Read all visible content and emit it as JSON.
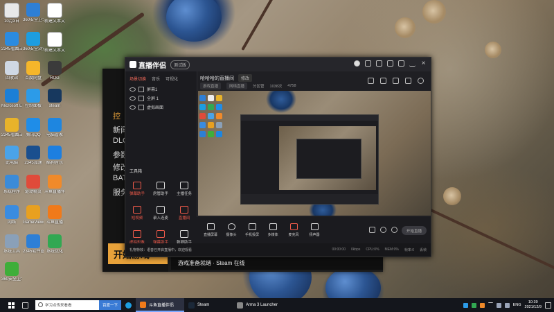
{
  "desktop_icons": [
    {
      "label": "10月3日",
      "color": "#e8e8e8"
    },
    {
      "label": "360安全卫士",
      "color": "#2e7fd6"
    },
    {
      "label": "新建文本文档",
      "color": "#ffffff"
    },
    {
      "label": "2345看图王",
      "color": "#2b8be0"
    },
    {
      "label": "360安全浏览器",
      "color": "#1d9de0"
    },
    {
      "label": "新建文本文档",
      "color": "#ffffff"
    },
    {
      "label": "回收站",
      "color": "#cfd8e4"
    },
    {
      "label": "百度网盘",
      "color": "#f5b62a"
    },
    {
      "label": "ROG",
      "color": "#3b3b3b"
    },
    {
      "label": "Microsoft Edge",
      "color": "#1b7fd6"
    },
    {
      "label": "控制面板",
      "color": "#2c9be8"
    },
    {
      "label": "steam",
      "color": "#17385e"
    },
    {
      "label": "2345看图王",
      "color": "#e8b32a"
    },
    {
      "label": "腾讯QQ",
      "color": "#1f8de8"
    },
    {
      "label": "电脑管家",
      "color": "#1e86e0"
    },
    {
      "label": "此电脑",
      "color": "#4aa3e8"
    },
    {
      "label": "2345加速",
      "color": "#1a4f8e"
    },
    {
      "label": "酷狗音乐",
      "color": "#1d7fe0"
    },
    {
      "label": "系统程序",
      "color": "#3b8bd8"
    },
    {
      "label": "驱动精灵",
      "color": "#e04b3a"
    },
    {
      "label": "斗鱼直播伴侣",
      "color": "#f08a2a"
    },
    {
      "label": "网络",
      "color": "#3a8ce0"
    },
    {
      "label": "GameViewer",
      "color": "#e8a020"
    },
    {
      "label": "斗鱼直播",
      "color": "#f07a1a"
    },
    {
      "label": "系统工具",
      "color": "#8aa0b8"
    },
    {
      "label": "2345软件管家",
      "color": "#2d7fd6"
    },
    {
      "label": "系统优化",
      "color": "#32a852"
    },
    {
      "label": "360安全卫士",
      "color": "#3fae3a"
    }
  ],
  "launcher": {
    "menu": [
      "控",
      "新闻",
      "DLC",
      "参数",
      "修改",
      "BAT",
      "服务"
    ],
    "play_label": "开始游戏",
    "status_text": "游戏准备就绪 · Steam 在线"
  },
  "app": {
    "title": "直播伴侣",
    "version": "测试版",
    "left_tabs": [
      "场景切换",
      "音乐",
      "可视化"
    ],
    "scenes": [
      "屏幕1",
      "全屏 1",
      "虚拟画面"
    ],
    "tools_header": "工具箱",
    "tools": [
      {
        "label": "弹幕助手",
        "red": true
      },
      {
        "label": "房管助手",
        "red": false
      },
      {
        "label": "主播任务",
        "red": false
      },
      {
        "label": "短视频",
        "red": true
      },
      {
        "label": "录入连麦",
        "red": false
      },
      {
        "label": "直播间",
        "red": true
      },
      {
        "label": "虚拟形象",
        "red": true
      },
      {
        "label": "弹幕助手",
        "red": true
      },
      {
        "label": "数据助手",
        "red": false
      }
    ],
    "room_title": "哈哈哈的直播间",
    "room_tag": "修改",
    "info": [
      "游戏直播",
      "网络直播",
      "分区管",
      "1038次",
      "4758"
    ],
    "controls": [
      {
        "label": "直播屏幕",
        "shape": "square"
      },
      {
        "label": "摄像头",
        "shape": "round"
      },
      {
        "label": "手机投屏",
        "shape": "square"
      },
      {
        "label": "多媒体",
        "shape": "square"
      },
      {
        "label": "麦克风",
        "shape": "mic"
      },
      {
        "label": "扬声器",
        "shape": "square"
      }
    ],
    "start_live": "开始直播",
    "notice": "礼物特效：语音已开启直播中，欢迎观看",
    "stats": [
      "00:00:00",
      "0kbps",
      "CPU:0%",
      "MEM:0%",
      "帧率:0",
      "丢帧"
    ]
  },
  "taskbar": {
    "search_placeholder": "学习点传来看看",
    "baidu_label": "百度一下",
    "apps": [
      {
        "label": "斗鱼直播伴侣",
        "color": "#f07a1a",
        "active": true
      },
      {
        "label": "Steam",
        "color": "#1b2838",
        "active": false
      },
      {
        "label": "Arma 3 Launcher",
        "color": "#888888",
        "active": false
      }
    ],
    "lang": "ENG",
    "time": "10:39",
    "date": "2021/12/9"
  }
}
